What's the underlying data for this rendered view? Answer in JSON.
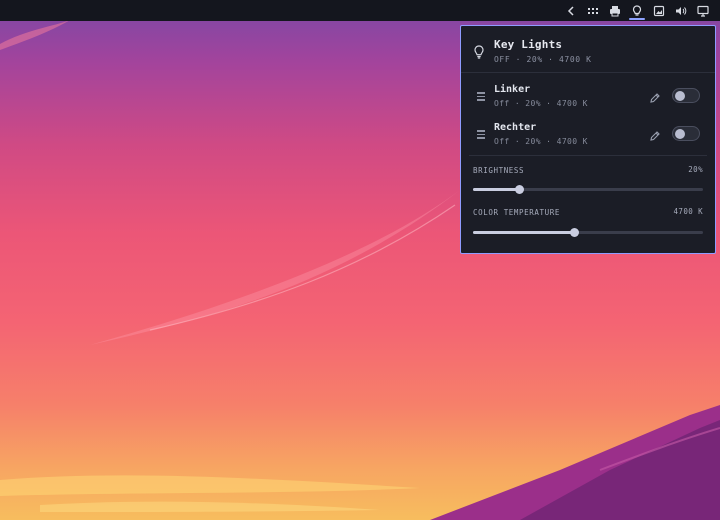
{
  "topbar": {
    "icons": [
      "chevron-left-icon",
      "grid-dots-icon",
      "printer-icon",
      "lightbulb-icon",
      "screenshot-icon",
      "volume-icon",
      "display-icon"
    ],
    "active_icon": "lightbulb-icon"
  },
  "panel": {
    "title": "Key Lights",
    "summary": "OFF · 20% · 4700 K",
    "lights": [
      {
        "name": "Linker",
        "status": "Off · 20% · 4700 K",
        "on": false
      },
      {
        "name": "Rechter",
        "status": "Off · 20% · 4700 K",
        "on": false
      }
    ],
    "brightness": {
      "label": "BRIGHTNESS",
      "value_text": "20%",
      "fraction": 0.2
    },
    "temperature": {
      "label": "COLOR TEMPERATURE",
      "value_text": "4700 K",
      "fraction": 0.44
    }
  },
  "colors": {
    "accent": "#8f9cff",
    "panel_bg": "#1b1d26",
    "topbar_bg": "#14161e"
  }
}
